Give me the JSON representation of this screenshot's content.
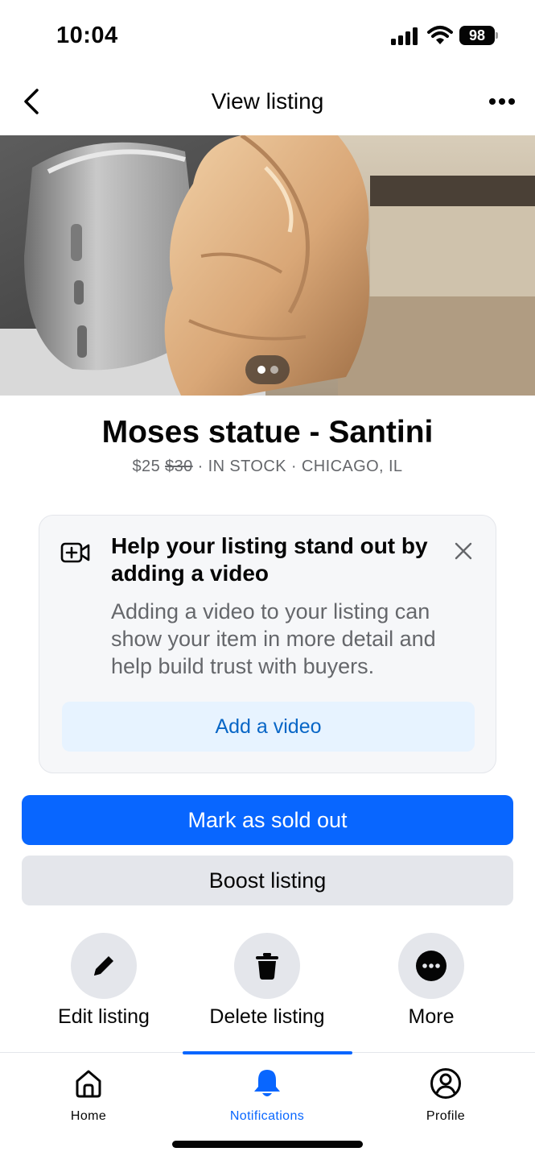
{
  "status_bar": {
    "time": "10:04",
    "battery": "98"
  },
  "header": {
    "title": "View listing"
  },
  "photo": {
    "page_count": 2,
    "active_page": 1
  },
  "listing": {
    "title": "Moses statue - Santini",
    "price": "$25",
    "original_price": "$30",
    "stock": "IN STOCK",
    "location": "CHICAGO, IL",
    "separator": " · "
  },
  "video_prompt": {
    "heading": "Help your listing stand out by adding a video",
    "body": "Adding a video to your listing can show your item in more detail and help build trust with buyers.",
    "button": "Add a video"
  },
  "buttons": {
    "mark_sold": "Mark as sold out",
    "boost": "Boost listing"
  },
  "actions": [
    {
      "label": "Edit listing",
      "icon": "pencil-icon"
    },
    {
      "label": "Delete listing",
      "icon": "trash-icon"
    },
    {
      "label": "More",
      "icon": "more-dots-icon"
    }
  ],
  "tabs": [
    {
      "label": "Home",
      "icon": "home-icon",
      "active": false
    },
    {
      "label": "Notifications",
      "icon": "bell-icon",
      "active": true
    },
    {
      "label": "Profile",
      "icon": "profile-icon",
      "active": false
    }
  ],
  "colors": {
    "primary": "#0866ff",
    "link": "#0866c6",
    "secondary_bg": "#e4e6eb",
    "muted_text": "#65676b"
  }
}
